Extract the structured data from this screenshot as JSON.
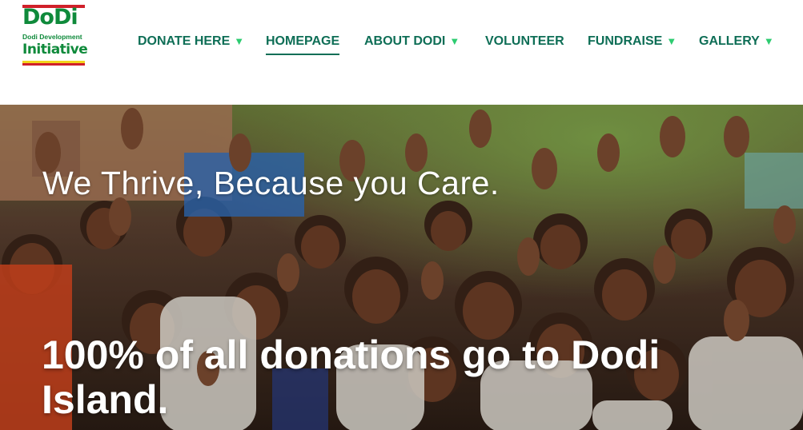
{
  "logo": {
    "line1": "DoDi",
    "line2": "Dodi Development",
    "line3": "Initiative"
  },
  "nav": {
    "items": [
      {
        "label": "DONATE HERE",
        "caret": "▼"
      },
      {
        "label": "HOMEPAGE",
        "caret": ""
      },
      {
        "label": "ABOUT DODI",
        "caret": "▼"
      },
      {
        "label": "VOLUNTEER",
        "caret": ""
      },
      {
        "label": "FUNDRAISE",
        "caret": "▼"
      },
      {
        "label": "GALLERY",
        "caret": "▼"
      }
    ],
    "active": "HOMEPAGE"
  },
  "hero": {
    "tagline": "We Thrive, Because you Care.",
    "headline": "100% of all donations go to Dodi Island."
  },
  "colors": {
    "nav_text": "#0e6e56",
    "caret": "#2ecc71",
    "logo_green": "#0f8a3b",
    "logo_red": "#d0202a",
    "logo_yellow": "#f2d51c",
    "hero_text": "#ffffff"
  }
}
